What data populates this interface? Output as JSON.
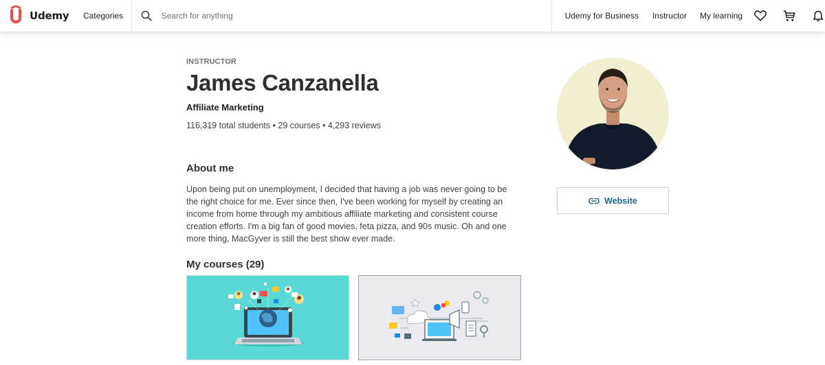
{
  "header": {
    "logo_text": "Udemy",
    "categories_label": "Categories",
    "search_placeholder": "Search for anything",
    "nav": {
      "business": "Udemy for Business",
      "instructor": "Instructor",
      "my_learning": "My learning"
    },
    "icons": [
      "search-icon",
      "heart-icon",
      "cart-icon",
      "bell-icon"
    ]
  },
  "profile": {
    "role_label": "INSTRUCTOR",
    "name": "James Canzanella",
    "headline": "Affiliate Marketing",
    "stats": "116,319 total students • 29 courses • 4,293 reviews"
  },
  "about": {
    "title": "About me",
    "text": "Upon being put on unemployment, I decided that having a job was never going to be the right choice for me. Ever since then, I've been working for myself by creating an income from home through my ambitious affiliate marketing and consistent course creation efforts. I'm a big fan of good movies, feta pizza, and 90s music. Oh and one more thing, MacGyver is still the best show ever made."
  },
  "courses": {
    "title": "My courses (29)"
  },
  "sidebar": {
    "website_label": "Website"
  },
  "colors": {
    "brand": "#ea5252",
    "link": "#1e6a8a",
    "card1_bg": "#5ad8d5",
    "card2_bg": "#ebebef"
  }
}
